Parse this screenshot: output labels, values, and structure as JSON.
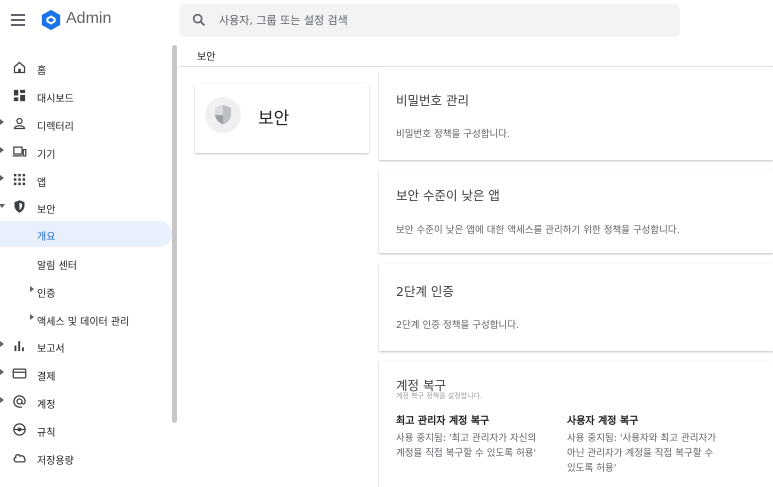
{
  "header": {
    "app_title": "Admin",
    "search_placeholder": "사용자, 그룹 또는 설정 검색"
  },
  "sidebar": {
    "items": [
      {
        "label": "홈",
        "icon": "home-icon"
      },
      {
        "label": "대시보드",
        "icon": "dashboard-icon"
      },
      {
        "label": "디렉터리",
        "icon": "person-icon"
      },
      {
        "label": "기기",
        "icon": "devices-icon"
      },
      {
        "label": "앱",
        "icon": "apps-grid-icon"
      },
      {
        "label": "보안",
        "icon": "shield-icon"
      },
      {
        "label": "개요"
      },
      {
        "label": "알림 센터"
      },
      {
        "label": "인증"
      },
      {
        "label": "액세스 및 데이터 관리"
      },
      {
        "label": "보고서",
        "icon": "bar-chart-icon"
      },
      {
        "label": "결제",
        "icon": "credit-card-icon"
      },
      {
        "label": "계정",
        "icon": "at-sign-icon"
      },
      {
        "label": "규칙",
        "icon": "rules-icon"
      },
      {
        "label": "저장용량",
        "icon": "cloud-icon"
      }
    ]
  },
  "breadcrumb": "보안",
  "security_card": {
    "title": "보안"
  },
  "cards": {
    "password": {
      "title": "비밀번호 관리",
      "desc": "비밀번호 정책을 구성합니다."
    },
    "less_secure": {
      "title": "보안 수준이 낮은 앱",
      "desc": "보안 수준이 낮은 앱에 대한 액세스를 관리하기 위한 정책을 구성합니다."
    },
    "two_step": {
      "title": "2단계 인증",
      "desc": "2단계 인증 정책을 구성합니다."
    },
    "recovery": {
      "title": "계정 복구",
      "subtitle": "계정 복구 정책을 설정합니다.",
      "super_admin_title": "최고 관리자 계정 복구",
      "super_admin_line1": "사용 중지됨: '최고 관리자가 자신의",
      "super_admin_line2": "계정을 직접 복구할 수 있도록 허용'",
      "user_title": "사용자 계정 복구",
      "user_line1": "사용 중지됨: '사용자와 최고 관리자가",
      "user_line2": "아닌 관리자가 계정을 직접 복구할 수",
      "user_line3": "있도록 허용'"
    }
  },
  "colors": {
    "accent": "#1967d2",
    "active_bg": "#e8f0fe",
    "logo_blue": "#1a73e8"
  }
}
